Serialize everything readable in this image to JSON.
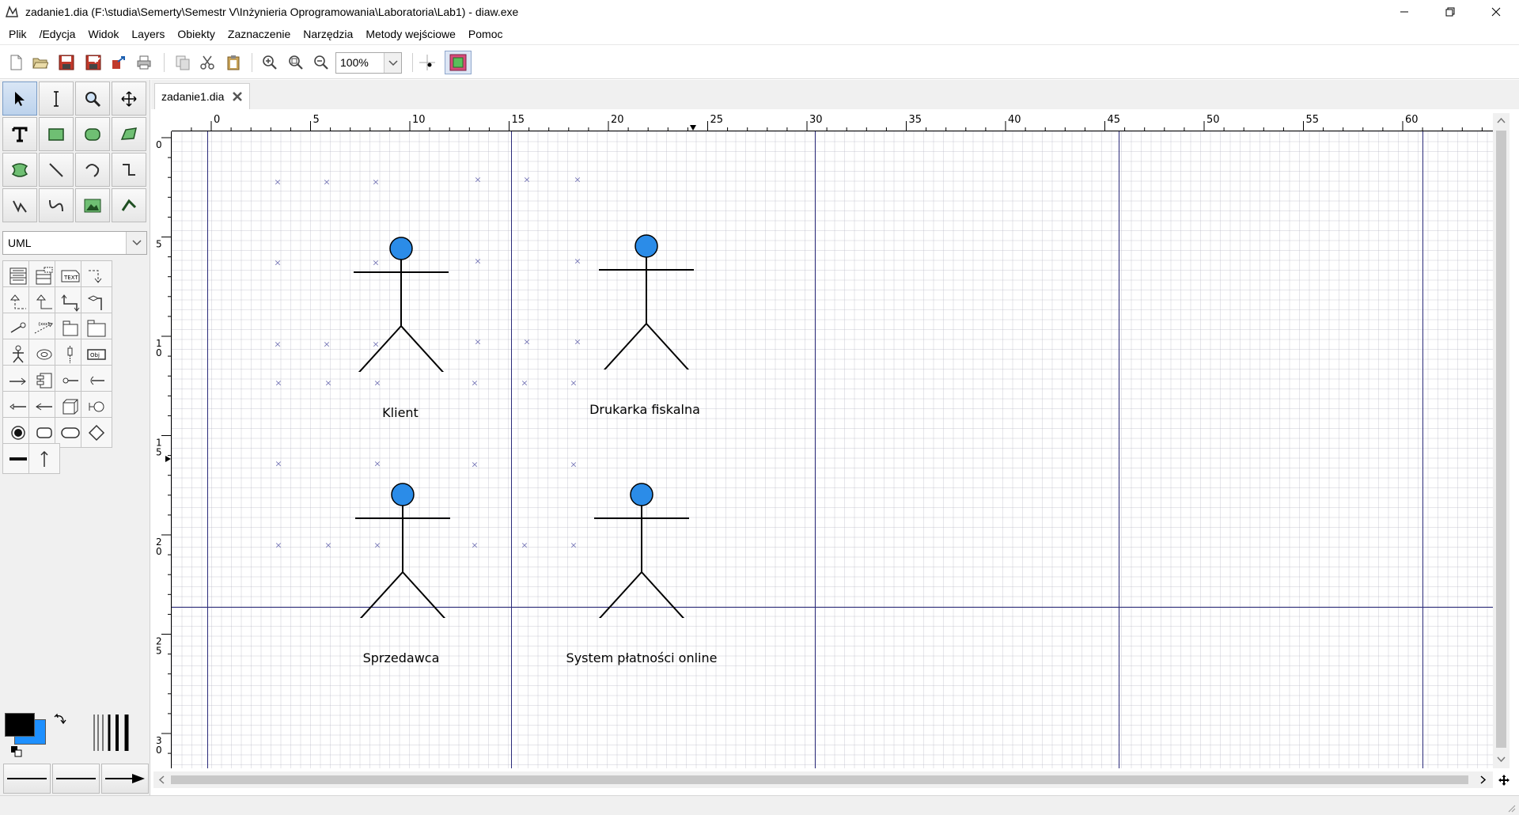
{
  "window": {
    "title": "zadanie1.dia (F:\\studia\\Semerty\\Semestr V\\Inżynieria Oprogramowania\\Laboratoria\\Lab1) - diaw.exe",
    "minimize_icon": "minimize-icon",
    "maximize_icon": "restore-icon",
    "close_icon": "close-icon"
  },
  "menu": {
    "items": [
      "Plik",
      "/Edycja",
      "Widok",
      "Layers",
      "Obiekty",
      "Zaznaczenie",
      "Narzędzia",
      "Metody wejściowe",
      "Pomoc"
    ]
  },
  "toolbar": {
    "zoom_value": "100%",
    "buttons": [
      "new-icon",
      "open-icon",
      "save-icon",
      "save-as-icon",
      "export-icon",
      "print-icon",
      "copy-icon",
      "cut-icon",
      "paste-icon",
      "zoom-in-icon",
      "zoom-fit-icon",
      "zoom-out-icon",
      "snap-to-grid-icon",
      "snap-to-objects-icon"
    ]
  },
  "toolbox": {
    "sheet": "UML"
  },
  "document": {
    "tab_label": "zadanie1.dia",
    "ruler_h_labels": [
      "0",
      "5",
      "10",
      "15",
      "20",
      "25",
      "30",
      "35",
      "40",
      "45",
      "50",
      "55",
      "60"
    ],
    "ruler_v_labels": [
      "0",
      "5",
      "10",
      "15",
      "20",
      "25",
      "30"
    ],
    "actors": [
      {
        "name": "Klient"
      },
      {
        "name": "Drukarka fiskalna"
      },
      {
        "name": "Sprzedawca"
      },
      {
        "name": "System płatności online"
      }
    ]
  },
  "colors": {
    "foreground": "#000000",
    "background": "#1e90ff",
    "actor_head": "#2b8ce8",
    "page_break": "#2b2b7a"
  }
}
